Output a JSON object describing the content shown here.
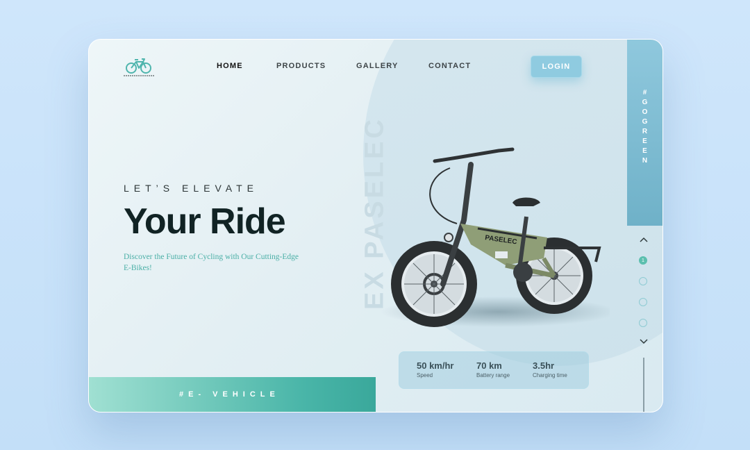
{
  "nav": {
    "items": [
      {
        "label": "HOME",
        "active": true
      },
      {
        "label": "PRODUCTS",
        "active": false
      },
      {
        "label": "GALLERY",
        "active": false
      },
      {
        "label": "CONTACT",
        "active": false
      }
    ],
    "login_label": "LOGIN"
  },
  "logo": {
    "icon": "bicycle-icon"
  },
  "side_panel": {
    "text": "#GOGREEN"
  },
  "hero": {
    "tagline": "LET’S ELEVATE",
    "headline": "Your Ride",
    "subtext": "Discover the Future of Cycling with Our Cutting-Edge E-Bikes!"
  },
  "bottom_bar": {
    "text": "#E- VEHICLE"
  },
  "product": {
    "brand_watermark": "EX PASELEC",
    "frame_brand": "PASELEC"
  },
  "stats": [
    {
      "value": "50 km/hr",
      "label": "Speed"
    },
    {
      "value": "70 km",
      "label": "Battery range"
    },
    {
      "value": "3.5hr",
      "label": "Charging time"
    }
  ],
  "pager": {
    "current": "1",
    "total_dots": 4
  },
  "colors": {
    "accent_teal": "#4aafa6",
    "login_blue": "#8fcbe0",
    "side_panel": "#7dbcd2",
    "headline": "#112324"
  }
}
